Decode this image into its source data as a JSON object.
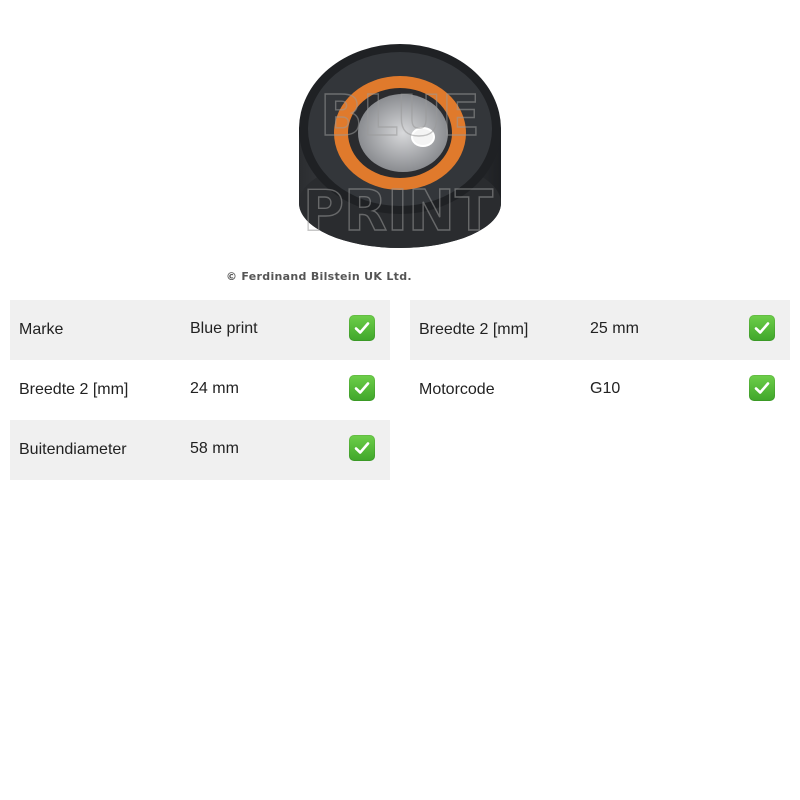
{
  "image": {
    "alt": "pulley",
    "watermark_lines": [
      "BLUE",
      "PRINT"
    ],
    "copyright": "© Ferdinand Bilstein UK Ltd."
  },
  "specs_left": [
    {
      "label": "Marke",
      "value": "Blue print",
      "icon": "check-icon",
      "shaded": true
    },
    {
      "label": "Breedte 2 [mm]",
      "value": "24 mm",
      "icon": "check-icon",
      "shaded": false
    },
    {
      "label": "Buitendiameter",
      "value": "58 mm",
      "icon": "check-icon",
      "shaded": true
    }
  ],
  "specs_right": [
    {
      "label": "Breedte 2 [mm]",
      "value": "25 mm",
      "icon": "check-icon",
      "shaded": true
    },
    {
      "label": "Motorcode",
      "value": "G10",
      "icon": "check-icon",
      "shaded": false
    }
  ],
  "colors": {
    "row_shade": "#f0f0f0",
    "check_green": "#3fa62a",
    "seal_orange": "#e07a2c"
  }
}
